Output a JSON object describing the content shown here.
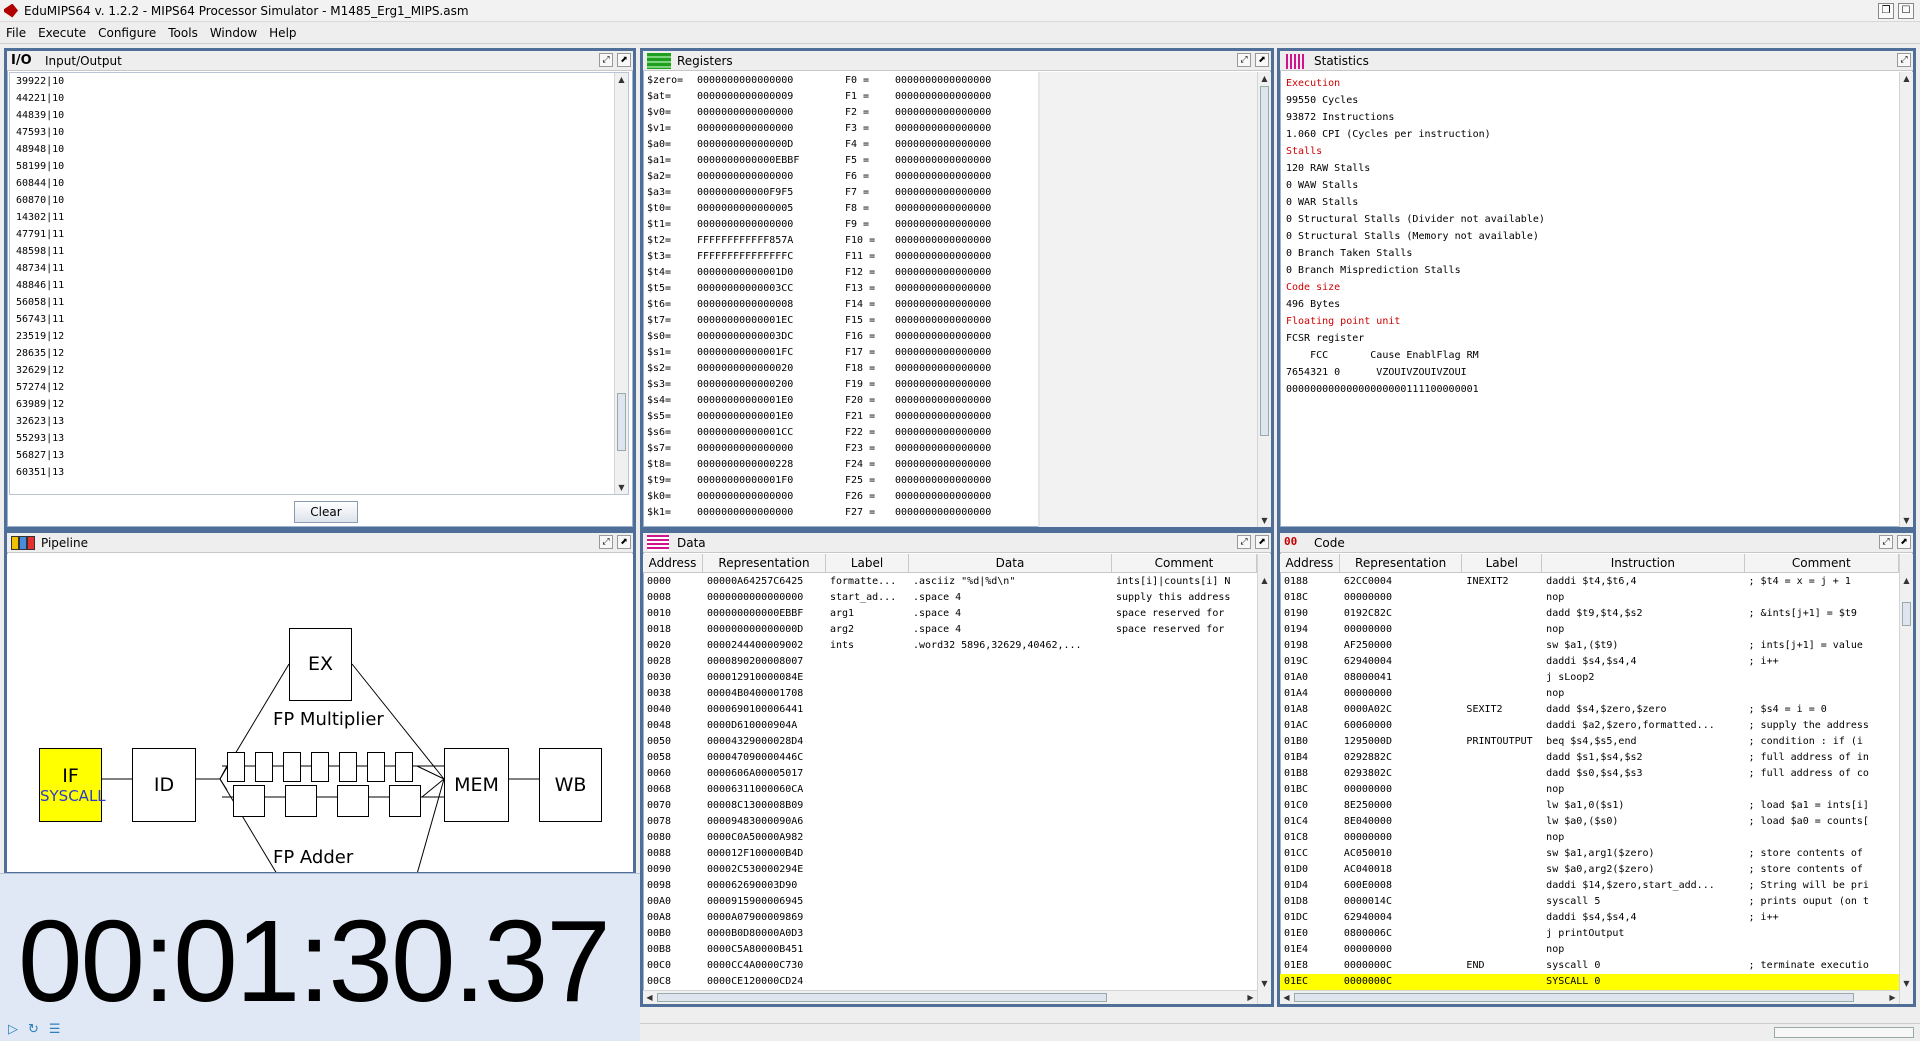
{
  "window": {
    "title": "EduMIPS64 v. 1.2.2 - MIPS64 Processor Simulator - M1485_Erg1_MIPS.asm"
  },
  "menu": [
    "File",
    "Execute",
    "Configure",
    "Tools",
    "Window",
    "Help"
  ],
  "io": {
    "title": "Input/Output",
    "lines": [
      "39922|10",
      "44221|10",
      "44839|10",
      "47593|10",
      "48948|10",
      "58199|10",
      "60844|10",
      "60870|10",
      "14302|11",
      "47791|11",
      "48598|11",
      "48734|11",
      "48846|11",
      "56058|11",
      "56743|11",
      "23519|12",
      "28635|12",
      "32629|12",
      "57274|12",
      "63989|12",
      "32623|13",
      "55293|13",
      "56827|13",
      "60351|13"
    ],
    "clear_label": "Clear"
  },
  "registers": {
    "title": "Registers",
    "rows": [
      [
        "$zero=",
        "0000000000000000",
        "F0 =",
        "0000000000000000"
      ],
      [
        "$at=",
        "0000000000000009",
        "F1 =",
        "0000000000000000"
      ],
      [
        "$v0=",
        "0000000000000000",
        "F2 =",
        "0000000000000000"
      ],
      [
        "$v1=",
        "0000000000000000",
        "F3 =",
        "0000000000000000"
      ],
      [
        "$a0=",
        "000000000000000D",
        "F4 =",
        "0000000000000000"
      ],
      [
        "$a1=",
        "0000000000000EBBF",
        "F5 =",
        "0000000000000000"
      ],
      [
        "$a2=",
        "0000000000000000",
        "F6 =",
        "0000000000000000"
      ],
      [
        "$a3=",
        "000000000000F9F5",
        "F7 =",
        "0000000000000000"
      ],
      [
        "$t0=",
        "0000000000000005",
        "F8 =",
        "0000000000000000"
      ],
      [
        "$t1=",
        "0000000000000000",
        "F9 =",
        "0000000000000000"
      ],
      [
        "$t2=",
        "FFFFFFFFFFFF857A",
        "F10 =",
        "0000000000000000"
      ],
      [
        "$t3=",
        "FFFFFFFFFFFFFFFC",
        "F11 =",
        "0000000000000000"
      ],
      [
        "$t4=",
        "00000000000001D0",
        "F12 =",
        "0000000000000000"
      ],
      [
        "$t5=",
        "00000000000003CC",
        "F13 =",
        "0000000000000000"
      ],
      [
        "$t6=",
        "0000000000000008",
        "F14 =",
        "0000000000000000"
      ],
      [
        "$t7=",
        "00000000000001EC",
        "F15 =",
        "0000000000000000"
      ],
      [
        "$s0=",
        "00000000000003DC",
        "F16 =",
        "0000000000000000"
      ],
      [
        "$s1=",
        "00000000000001FC",
        "F17 =",
        "0000000000000000"
      ],
      [
        "$s2=",
        "0000000000000020",
        "F18 =",
        "0000000000000000"
      ],
      [
        "$s3=",
        "0000000000000200",
        "F19 =",
        "0000000000000000"
      ],
      [
        "$s4=",
        "00000000000001E0",
        "F20 =",
        "0000000000000000"
      ],
      [
        "$s5=",
        "00000000000001E0",
        "F21 =",
        "0000000000000000"
      ],
      [
        "$s6=",
        "00000000000001CC",
        "F22 =",
        "0000000000000000"
      ],
      [
        "$s7=",
        "0000000000000000",
        "F23 =",
        "0000000000000000"
      ],
      [
        "$t8=",
        "0000000000000228",
        "F24 =",
        "0000000000000000"
      ],
      [
        "$t9=",
        "00000000000001F0",
        "F25 =",
        "0000000000000000"
      ],
      [
        "$k0=",
        "0000000000000000",
        "F26 =",
        "0000000000000000"
      ],
      [
        "$k1=",
        "0000000000000000",
        "F27 =",
        "0000000000000000"
      ]
    ]
  },
  "statistics": {
    "title": "Statistics",
    "lines": [
      {
        "t": "Execution",
        "hdr": true
      },
      {
        "t": "99550 Cycles",
        "hdr": false
      },
      {
        "t": "93872 Instructions",
        "hdr": false
      },
      {
        "t": "1.060 CPI (Cycles per instruction)",
        "hdr": false
      },
      {
        "t": "Stalls",
        "hdr": true
      },
      {
        "t": "120 RAW Stalls",
        "hdr": false
      },
      {
        "t": "0 WAW Stalls",
        "hdr": false
      },
      {
        "t": "0 WAR Stalls",
        "hdr": false
      },
      {
        "t": "0 Structural Stalls (Divider not available)",
        "hdr": false
      },
      {
        "t": "0 Structural Stalls (Memory not available)",
        "hdr": false
      },
      {
        "t": "0 Branch Taken Stalls",
        "hdr": false
      },
      {
        "t": "0 Branch Misprediction Stalls",
        "hdr": false
      },
      {
        "t": "Code size",
        "hdr": true
      },
      {
        "t": "496 Bytes",
        "hdr": false
      },
      {
        "t": "Floating point unit",
        "hdr": true
      },
      {
        "t": "FCSR register",
        "hdr": false
      },
      {
        "t": "    FCC       Cause EnablFlag RM",
        "hdr": false
      },
      {
        "t": "7654321 0      VZOUIVZOUIVZOUI",
        "hdr": false
      },
      {
        "t": "00000000000000000000111100000001",
        "hdr": false
      }
    ]
  },
  "pipeline": {
    "title": "Pipeline",
    "stages": {
      "if": "IF",
      "id": "ID",
      "ex": "EX",
      "mem": "MEM",
      "wb": "WB"
    },
    "if_instruction": "SYSCALL",
    "fp_multiplier": "FP Multiplier",
    "fp_adder": "FP Adder",
    "colors": {
      "if_active": "#ffff00",
      "if_text": "#2e3bd0"
    }
  },
  "timer": {
    "value": "00:01:30.37"
  },
  "data": {
    "title": "Data",
    "columns": [
      "Address",
      "Representation",
      "Label",
      "Data",
      "Comment"
    ],
    "rows": [
      [
        "0000",
        "00000A64257C6425",
        "formatte...",
        ".asciiz \"%d|%d\\n\"",
        "ints[i]|counts[i] N"
      ],
      [
        "0008",
        "0000000000000000",
        "start_ad...",
        ".space 4",
        "supply this address"
      ],
      [
        "0010",
        "000000000000EBBF",
        "arg1",
        ".space 4",
        "space reserved for"
      ],
      [
        "0018",
        "000000000000000D",
        "arg2",
        ".space 4",
        "space reserved for"
      ],
      [
        "0020",
        "0000244400009002",
        "ints",
        ".word32 5896,32629,40462,...",
        ""
      ],
      [
        "0028",
        "0000890200008007",
        "",
        "",
        ""
      ],
      [
        "0030",
        "000012910000084E",
        "",
        "",
        ""
      ],
      [
        "0038",
        "00004B0400001708",
        "",
        "",
        ""
      ],
      [
        "0040",
        "0000690100006441",
        "",
        "",
        ""
      ],
      [
        "0048",
        "0000D610000904A",
        "",
        "",
        ""
      ],
      [
        "0050",
        "00004329000028D4",
        "",
        "",
        ""
      ],
      [
        "0058",
        "000047090000446C",
        "",
        "",
        ""
      ],
      [
        "0060",
        "0000606A00005017",
        "",
        "",
        ""
      ],
      [
        "0068",
        "00006311000060CA",
        "",
        "",
        ""
      ],
      [
        "0070",
        "00008C1300008B09",
        "",
        "",
        ""
      ],
      [
        "0078",
        "00009483000090A6",
        "",
        "",
        ""
      ],
      [
        "0080",
        "0000C0A50000A982",
        "",
        "",
        ""
      ],
      [
        "0088",
        "000012F100000B4D",
        "",
        "",
        ""
      ],
      [
        "0090",
        "00002C530000294E",
        "",
        "",
        ""
      ],
      [
        "0098",
        "000062690003D90",
        "",
        "",
        ""
      ],
      [
        "00A0",
        "0000915900006945",
        "",
        "",
        ""
      ],
      [
        "00A8",
        "0000A07900009869",
        "",
        "",
        ""
      ],
      [
        "00B0",
        "0000B0D80000A0D3",
        "",
        "",
        ""
      ],
      [
        "00B8",
        "0000C5A80000B451",
        "",
        "",
        ""
      ],
      [
        "00C0",
        "0000CC4A0000C730",
        "",
        "",
        ""
      ],
      [
        "00C8",
        "0000CE120000CD24",
        "",
        "",
        ""
      ]
    ]
  },
  "code": {
    "title": "Code",
    "columns": [
      "Address",
      "Representation",
      "Label",
      "Instruction",
      "Comment"
    ],
    "rows": [
      [
        "0188",
        "62CC0004",
        "INEXIT2",
        "daddi $t4,$t6,4",
        "; $t4 = x = j + 1"
      ],
      [
        "018C",
        "00000000",
        "",
        "nop",
        ""
      ],
      [
        "0190",
        "0192C82C",
        "",
        "dadd $t9,$t4,$s2",
        "; &ints[j+1] = $t9"
      ],
      [
        "0194",
        "00000000",
        "",
        "nop",
        ""
      ],
      [
        "0198",
        "AF250000",
        "",
        "sw $a1,($t9)",
        "; ints[j+1] = value"
      ],
      [
        "019C",
        "62940004",
        "",
        "daddi $s4,$s4,4",
        "; i++"
      ],
      [
        "01A0",
        "08000041",
        "",
        "j sLoop2",
        ""
      ],
      [
        "01A4",
        "00000000",
        "",
        "nop",
        ""
      ],
      [
        "01A8",
        "0000A02C",
        "SEXIT2",
        "dadd $s4,$zero,$zero",
        "; $s4 = i = 0"
      ],
      [
        "01AC",
        "60060000",
        "",
        "daddi $a2,$zero,formatted...",
        "; supply the address"
      ],
      [
        "01B0",
        "1295000D",
        "PRINTOUTPUT",
        "beq $s4,$s5,end",
        "; condition : if (i"
      ],
      [
        "01B4",
        "0292882C",
        "",
        "dadd $s1,$s4,$s2",
        "; full address of in"
      ],
      [
        "01B8",
        "0293802C",
        "",
        "dadd $s0,$s4,$s3",
        "; full address of co"
      ],
      [
        "01BC",
        "00000000",
        "",
        "nop",
        ""
      ],
      [
        "01C0",
        "8E250000",
        "",
        "lw $a1,0($s1)",
        "; load $a1 = ints[i]"
      ],
      [
        "01C4",
        "8E040000",
        "",
        "lw $a0,($s0)",
        "; load $a0 = counts["
      ],
      [
        "01C8",
        "00000000",
        "",
        "nop",
        ""
      ],
      [
        "01CC",
        "AC050010",
        "",
        "sw $a1,arg1($zero)",
        "; store contents of"
      ],
      [
        "01D0",
        "AC040018",
        "",
        "sw $a0,arg2($zero)",
        "; store contents of"
      ],
      [
        "01D4",
        "600E0008",
        "",
        "daddi $14,$zero,start_add...",
        "; String will be pri"
      ],
      [
        "01D8",
        "0000014C",
        "",
        "syscall 5",
        "; prints ouput (on t"
      ],
      [
        "01DC",
        "62940004",
        "",
        "daddi $s4,$s4,4",
        "; i++"
      ],
      [
        "01E0",
        "0800006C",
        "",
        "j printOutput",
        ""
      ],
      [
        "01E4",
        "00000000",
        "",
        "nop",
        ""
      ],
      [
        "01E8",
        "0000000C",
        "END",
        "syscall 0",
        "; terminate executio"
      ],
      [
        "01EC",
        "0000000C",
        "",
        "SYSCALL 0",
        ""
      ]
    ],
    "highlight_index": 25,
    "highlight_color": "#ffff00"
  }
}
